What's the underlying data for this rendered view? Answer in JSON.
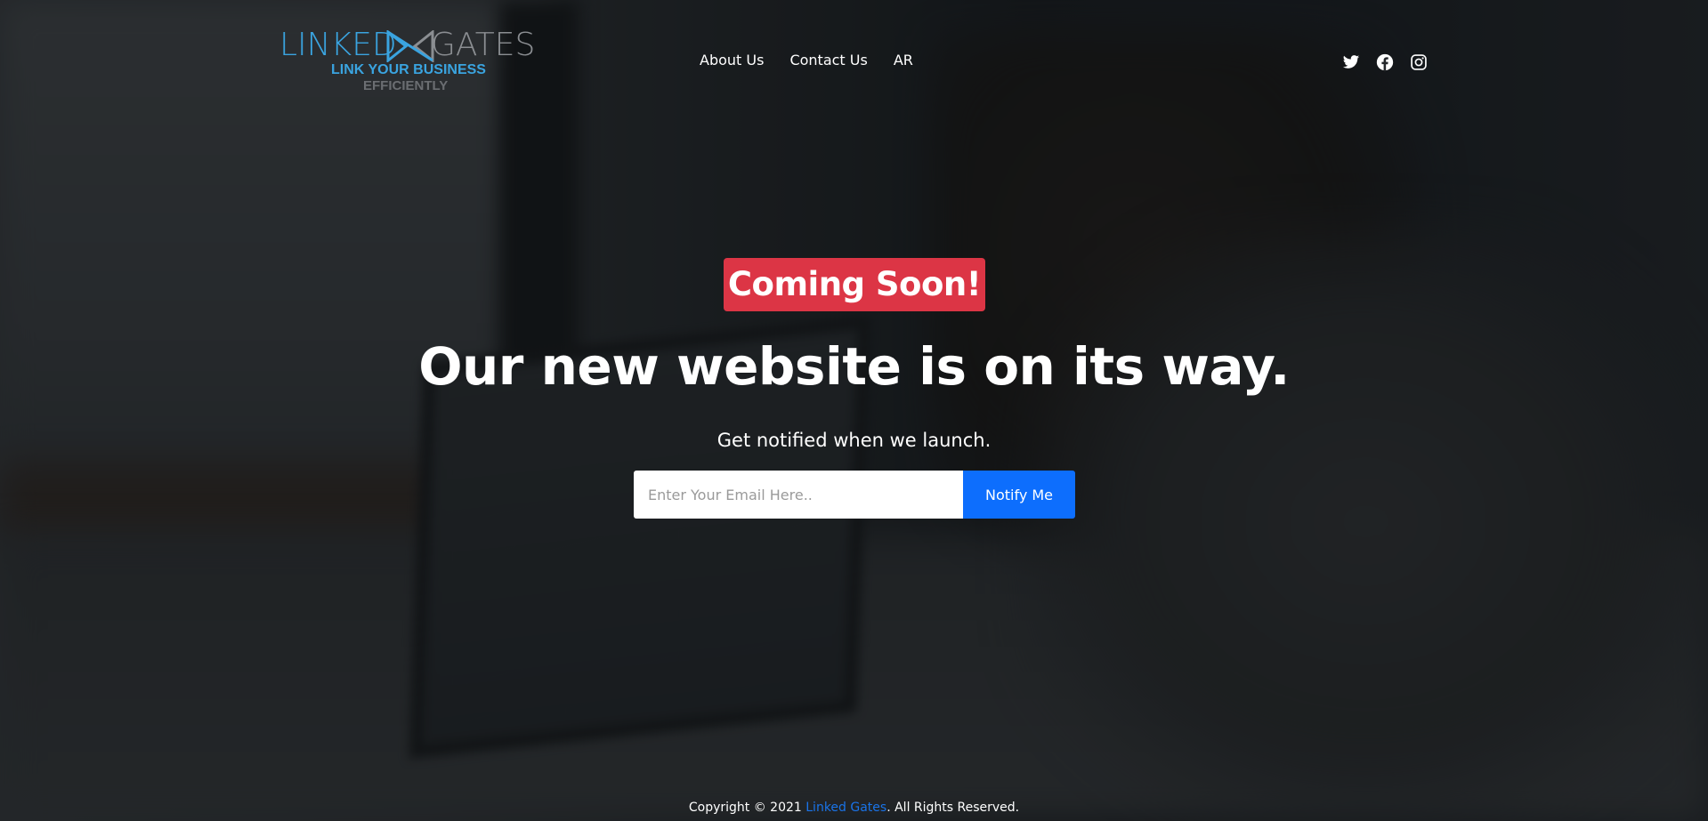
{
  "logo": {
    "word_left": "LINKED",
    "word_right": "GATES",
    "tagline_line1": "LINK YOUR BUSINESS",
    "tagline_line2": "EFFICIENTLY",
    "colors": {
      "primary": "#3aa4e0",
      "secondary": "#8b8e92"
    }
  },
  "nav": {
    "items": [
      {
        "label": "About Us"
      },
      {
        "label": "Contact Us"
      },
      {
        "label": "AR"
      }
    ]
  },
  "social": {
    "icons": [
      "twitter-icon",
      "facebook-icon",
      "instagram-icon"
    ]
  },
  "hero": {
    "badge": "Coming Soon!",
    "headline": "Our new website is on its way.",
    "subtext": "Get notified when we launch.",
    "email_placeholder": "Enter Your Email Here..",
    "email_value": "",
    "button_label": "Notify Me",
    "colors": {
      "badge": "#dc3545",
      "button": "#0d6efd"
    }
  },
  "footer": {
    "prefix": "Copyright © 2021 ",
    "company_link": "Linked Gates",
    "suffix": ". All Rights Reserved."
  }
}
